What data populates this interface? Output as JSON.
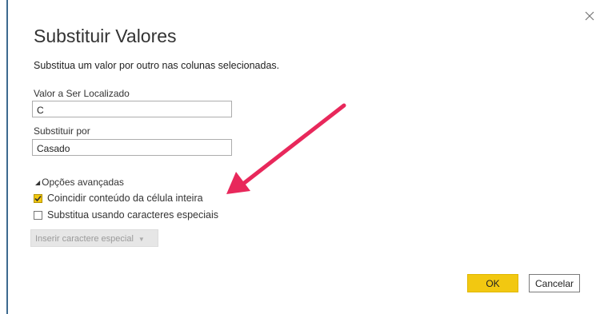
{
  "dialog": {
    "title": "Substituir Valores",
    "description": "Substitua um valor por outro nas colunas selecionadas."
  },
  "find": {
    "label": "Valor a Ser Localizado",
    "value": "C"
  },
  "replace": {
    "label": "Substituir por",
    "value": "Casado"
  },
  "advanced": {
    "label": "Opções avançadas",
    "toggle_icon": "collapse-triangle-icon",
    "options": [
      {
        "label": "Coincidir conteúdo da célula inteira",
        "checked": true
      },
      {
        "label": "Substitua usando caracteres especiais",
        "checked": false
      }
    ],
    "insert_label": "Inserir caractere especial"
  },
  "buttons": {
    "ok": "OK",
    "cancel": "Cancelar"
  },
  "colors": {
    "accent": "#f2c811",
    "arrow": "#e8285b",
    "dialog_border": "#3d6a8f"
  }
}
